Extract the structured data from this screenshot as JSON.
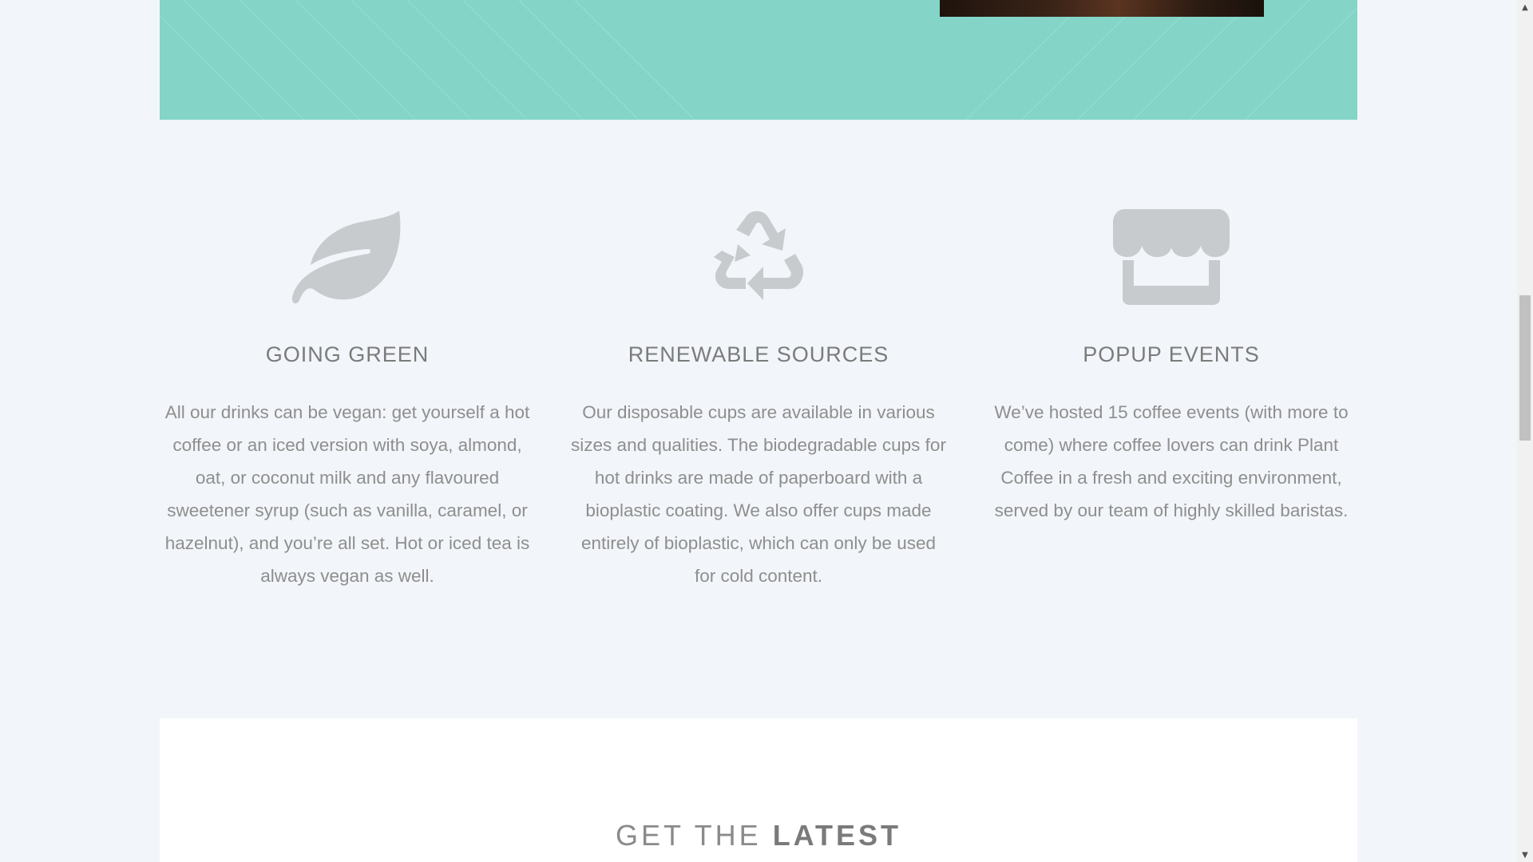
{
  "features": [
    {
      "icon": "leaf-icon",
      "title": "GOING GREEN",
      "text": "All our drinks can be vegan: get yourself a hot coffee or an iced version with soya, almond, oat, or coconut milk and any flavoured sweetener syrup (such as vanilla, caramel, or hazelnut), and you’re all set. Hot or iced tea is always vegan as well."
    },
    {
      "icon": "recycle-icon",
      "title": "RENEWABLE SOURCES",
      "text": "Our disposable cups are available in various sizes and qualities. The biodegradable cups for hot drinks are made of paperboard with a bioplastic coating. We also offer cups made entirely of bioplastic, which can only be used for cold content."
    },
    {
      "icon": "store-icon",
      "title": "POPUP EVENTS",
      "text": "We’ve hosted 15 coffee events (with more to come) where coffee lovers can drink Plant Coffee in a fresh and exciting environment, served by our team of highly skilled baristas."
    }
  ],
  "latest": {
    "prefix": "GET THE ",
    "emphasis": "LATEST"
  },
  "colors": {
    "banner": "#84d4c8",
    "background": "#f2f5f9",
    "icon": "#c8cbcd",
    "heading": "#7b7b7b",
    "body_text": "#8e8e8e"
  }
}
